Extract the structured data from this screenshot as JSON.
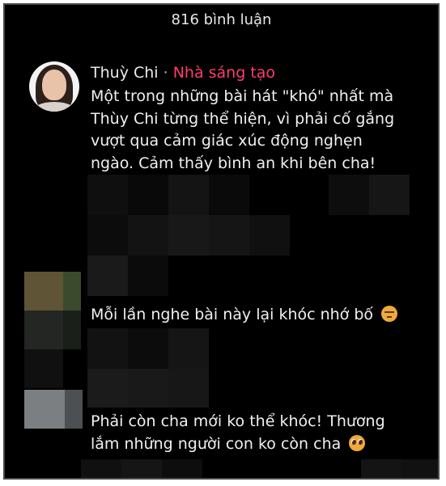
{
  "header": {
    "comment_count_label": "816 bình luận"
  },
  "creator_comment": {
    "author": "Thuỳ Chi",
    "separator": "·",
    "role": "Nhà sáng tạo",
    "text_lines": [
      "Một trong những bài hát \"khó\" nhất mà",
      "Thùy Chi từng thể hiện, vì phải cố gắng",
      "vượt qua cảm giác xúc động nghẹn",
      "ngào. Cảm thấy bình an khi bên cha!"
    ]
  },
  "comment_2": {
    "text": "Mỗi lần nghe bài này lại khóc nhớ bố",
    "emoji": "pensive-face-icon"
  },
  "comment_3": {
    "text_lines": [
      "Phải còn cha mới ko thể khóc! Thương",
      "lắm những người con ko còn cha"
    ],
    "emoji": "pleading-face-icon"
  },
  "colors": {
    "background": "#000000",
    "text": "#f0f0f0",
    "creator_role": "#ff3d6e",
    "border": "#4a4a4a"
  }
}
